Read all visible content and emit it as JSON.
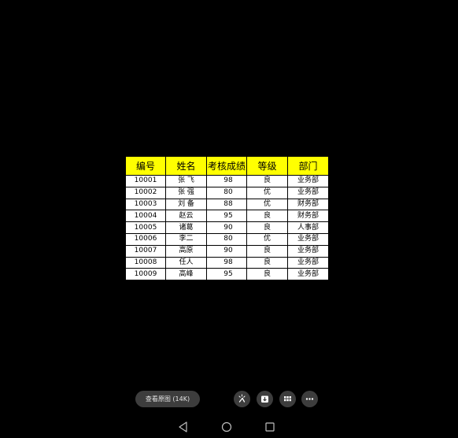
{
  "table": {
    "headers": [
      "编号",
      "姓名",
      "考核成绩",
      "等级",
      "部门"
    ],
    "rows": [
      [
        "10001",
        "张 飞",
        "98",
        "良",
        "业务部"
      ],
      [
        "10002",
        "张 强",
        "80",
        "优",
        "业务部"
      ],
      [
        "10003",
        "刘 备",
        "88",
        "优",
        "财务部"
      ],
      [
        "10004",
        "赵云",
        "95",
        "良",
        "财务部"
      ],
      [
        "10005",
        "诸葛",
        "90",
        "良",
        "人事部"
      ],
      [
        "10006",
        "李二",
        "80",
        "优",
        "业务部"
      ],
      [
        "10007",
        "高原",
        "90",
        "良",
        "业务部"
      ],
      [
        "10008",
        "任人",
        "98",
        "良",
        "业务部"
      ],
      [
        "10009",
        "高峰",
        "95",
        "良",
        "业务部"
      ]
    ]
  },
  "toolbar": {
    "view_original_label": "查看原图 (14K)",
    "buttons": [
      {
        "icon": "magic-wand-icon"
      },
      {
        "icon": "download-icon"
      },
      {
        "icon": "grid-icon"
      },
      {
        "icon": "more-icon"
      }
    ]
  },
  "navbar": {
    "buttons": [
      {
        "icon": "back-triangle-icon"
      },
      {
        "icon": "home-circle-icon"
      },
      {
        "icon": "recents-square-icon"
      }
    ]
  },
  "colors": {
    "background": "#000000",
    "header_fill": "#ffff00",
    "button_fill": "#3d3d3d"
  }
}
